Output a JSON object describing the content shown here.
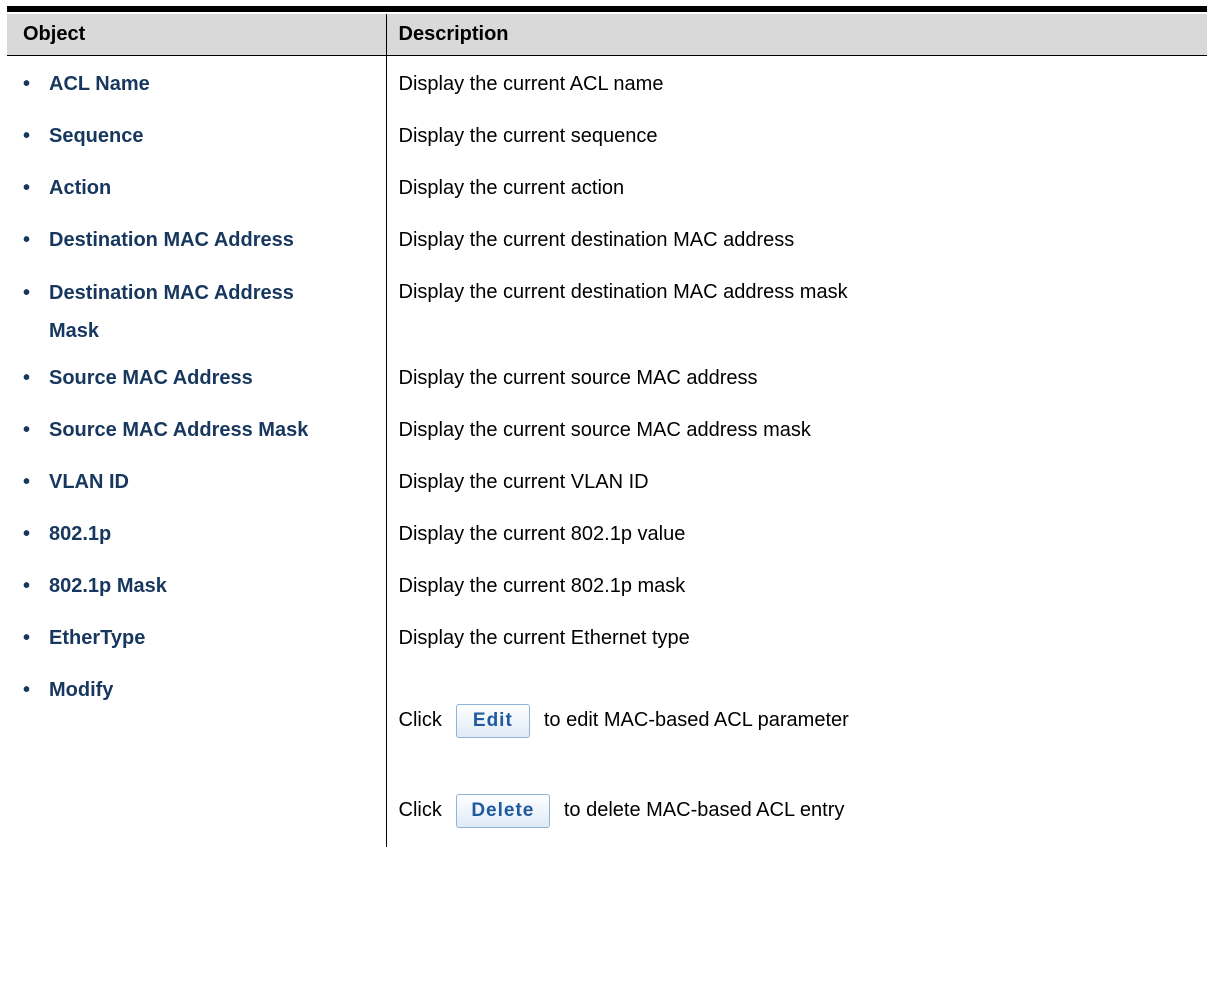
{
  "table": {
    "headers": {
      "object": "Object",
      "description": "Description"
    },
    "rows": [
      {
        "object": "ACL Name",
        "description": "Display the current ACL name"
      },
      {
        "object": "Sequence",
        "description": "Display the current sequence"
      },
      {
        "object": "Action",
        "description": "Display the current action"
      },
      {
        "object": "Destination MAC Address",
        "description": "Display the current destination MAC address"
      },
      {
        "object_line1": "Destination MAC Address",
        "object_line2": "Mask",
        "description": "Display the current destination MAC address mask"
      },
      {
        "object": "Source MAC Address",
        "description": "Display the current source MAC address"
      },
      {
        "object": "Source MAC Address Mask",
        "description": "Display the current source MAC address mask"
      },
      {
        "object": "VLAN ID",
        "description": "Display the current VLAN ID"
      },
      {
        "object": "802.1p",
        "description": "Display the current 802.1p value"
      },
      {
        "object": "802.1p Mask",
        "description": "Display the current 802.1p mask"
      },
      {
        "object": "EtherType",
        "description": "Display the current Ethernet type"
      }
    ],
    "modify": {
      "object": "Modify",
      "edit_prefix": "Click",
      "edit_button": "Edit",
      "edit_suffix": "to edit MAC-based ACL parameter",
      "delete_prefix": "Click",
      "delete_button": "Delete",
      "delete_suffix": "to delete MAC-based ACL entry"
    }
  }
}
